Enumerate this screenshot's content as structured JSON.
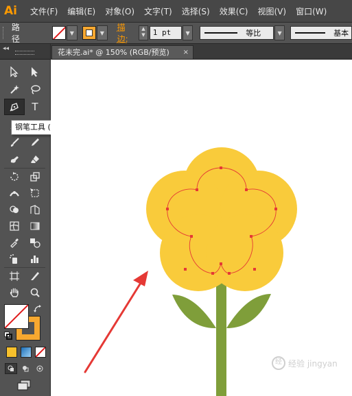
{
  "app": {
    "logo": "Ai"
  },
  "menu": [
    "文件(F)",
    "编辑(E)",
    "对象(O)",
    "文字(T)",
    "选择(S)",
    "效果(C)",
    "视图(V)",
    "窗口(W)"
  ],
  "control": {
    "label": "路径",
    "stroke_label": "描边:",
    "stroke_weight": "1 pt",
    "profile_label": "等比",
    "brush_label": "基本"
  },
  "document": {
    "tab_title": "花未完.ai* @ 150% (RGB/预览)",
    "close_glyph": "×"
  },
  "tools": {
    "tooltip": "钢笔工具 (P)",
    "type_glyph": "T"
  },
  "colors": {
    "petal": "#f9cb3b",
    "path": "#e53935",
    "stem": "#7f9e3a",
    "arrow": "#e53935",
    "stroke_swatch": "#f7a830",
    "accent": "#ff9a00"
  },
  "watermark": {
    "text": "经验 jingyan"
  }
}
